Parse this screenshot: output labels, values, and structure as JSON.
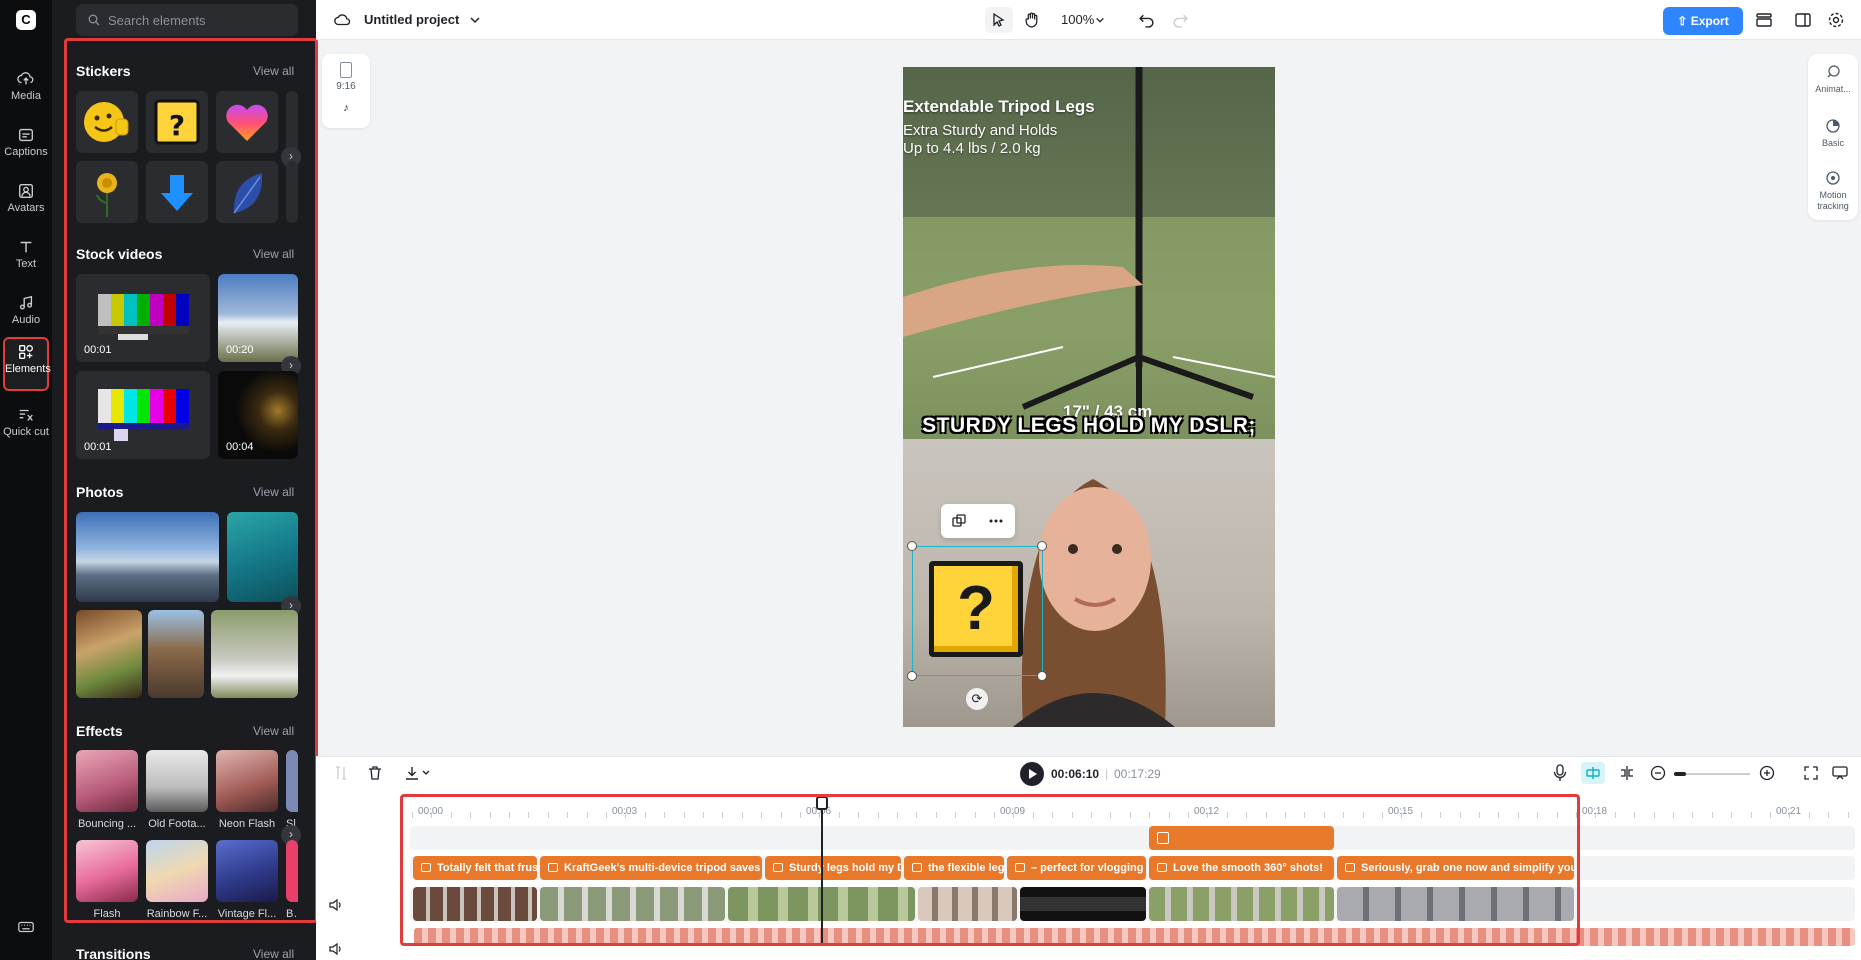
{
  "app": {
    "project_title": "Untitled project",
    "zoom": "100%",
    "export_label": "Export"
  },
  "rail": {
    "items": [
      {
        "label": "Media",
        "icon": "cloud-upload-icon"
      },
      {
        "label": "Captions",
        "icon": "captions-icon"
      },
      {
        "label": "Avatars",
        "icon": "avatar-icon"
      },
      {
        "label": "Text",
        "icon": "text-icon"
      },
      {
        "label": "Audio",
        "icon": "music-note-icon"
      },
      {
        "label": "Elements",
        "icon": "shapes-icon",
        "active": true
      },
      {
        "label": "Quick cut",
        "icon": "scissors-icon"
      }
    ]
  },
  "panel": {
    "search_placeholder": "Search elements",
    "view_all": "View all",
    "sections": {
      "stickers": "Stickers",
      "stock_videos": "Stock videos",
      "photos": "Photos",
      "effects": "Effects",
      "transitions": "Transitions"
    },
    "stock_videos": [
      {
        "duration": "00:01"
      },
      {
        "duration": "00:20"
      },
      {
        "duration": "00:01"
      },
      {
        "duration": "00:04"
      }
    ],
    "effects": [
      {
        "name": "Bouncing ..."
      },
      {
        "name": "Old Foota..."
      },
      {
        "name": "Neon Flash"
      },
      {
        "name": "Sl"
      },
      {
        "name": "Flash"
      },
      {
        "name": "Rainbow F..."
      },
      {
        "name": "Vintage Fl..."
      },
      {
        "name": "Be"
      }
    ]
  },
  "canvas": {
    "aspect_ratio": "9:16",
    "overlay_lines": [
      "Extendable Tripod Legs",
      "Extra Sturdy and Holds",
      "Up to 4.4 lbs / 2.0 kg"
    ],
    "measure_text": "17\" / 43 cm",
    "caption": "STURDY LEGS HOLD MY DSLR;",
    "sticker_glyph": "?"
  },
  "right_panel": {
    "items": [
      {
        "label": "Animat...",
        "icon": "animation-icon"
      },
      {
        "label": "Basic",
        "icon": "basic-icon"
      },
      {
        "label": "Motion tracking",
        "icon": "target-icon"
      }
    ]
  },
  "timeline": {
    "current_time": "00:06:10",
    "separator": "|",
    "total_time": "00:17:29",
    "ruler": [
      "00:00",
      "00:03",
      "00:06",
      "00:09",
      "00:12",
      "00:15",
      "00:18",
      "00:21"
    ],
    "text_clips": [
      "Totally felt that frus",
      "KraftGeek's multi-device tripod saves",
      "Sturdy legs hold my D",
      "the flexible leg",
      "– perfect for vlogging",
      "Love the smooth 360° shots!",
      "Seriously, grab one now and simplify your"
    ]
  },
  "colors": {
    "accent": "#2f85ff",
    "highlight": "#e23b3b",
    "clip_orange": "#e8792b",
    "selection": "#1fb5c9"
  }
}
